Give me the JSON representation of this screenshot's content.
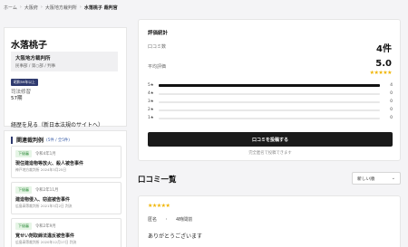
{
  "breadcrumb": {
    "home": "ホーム",
    "prefecture": "大阪府",
    "court": "大阪地方裁判所",
    "current": "水落桃子 裁判官",
    "separator": "›"
  },
  "judge": {
    "name": "水落桃子",
    "court": "大阪地方裁判所",
    "division": "民事部 / 第○部 / 判事",
    "birth_tag": "昭和59年以上",
    "experience_label": "司法修習",
    "experience_value": "57期",
    "career_link": "経歴を見る（新日本法規のサイトへ）"
  },
  "related": {
    "title": "関連裁判例",
    "count": "(5件 / 全5件)",
    "cases": [
      {
        "badge": "下級審",
        "date": "令和4年1月",
        "title": "現住建造物等放火、殺人被告事件",
        "meta": "神戸地方裁判所 2024年3月25日"
      },
      {
        "badge": "下級審",
        "date": "令和2年11月",
        "title": "建造物侵入、窃盗被告事件",
        "meta": "広島高等裁判所 2021年3月2日 判決"
      },
      {
        "badge": "下級審",
        "date": "令和2年9月",
        "title": "覚せい剤取締法違反被告事件",
        "meta": "広島高等裁判所 2020年12月17日 判決"
      }
    ]
  },
  "stats": {
    "title": "評価統計",
    "review_count_label": "口コミ数",
    "review_count_value": "4件",
    "avg_label": "平均評価",
    "avg_value": "5.0",
    "avg_stars": "★★★★★",
    "distribution": [
      {
        "label": "5★",
        "count": "4",
        "fraction": 1.0
      },
      {
        "label": "4★",
        "count": "0",
        "fraction": 0
      },
      {
        "label": "3★",
        "count": "0",
        "fraction": 0
      },
      {
        "label": "2★",
        "count": "0",
        "fraction": 0
      },
      {
        "label": "1★",
        "count": "0",
        "fraction": 0
      }
    ],
    "post_button": "口コミを投稿する",
    "anon_note": "完全匿名で投稿できます"
  },
  "reviews": {
    "title": "口コミ一覧",
    "sort_value": "新しい順",
    "sort_chevron": "⌄",
    "items": [
      {
        "stars": "★★★★★",
        "author": "匿名",
        "dot": "・",
        "time": "4時間前",
        "body": "ありがとうございます"
      }
    ]
  },
  "colors": {
    "accent_dark": "#1a1a1a",
    "star": "#f0b400",
    "badge_green": "#2d8a3a",
    "navy": "#2f3a6f"
  }
}
